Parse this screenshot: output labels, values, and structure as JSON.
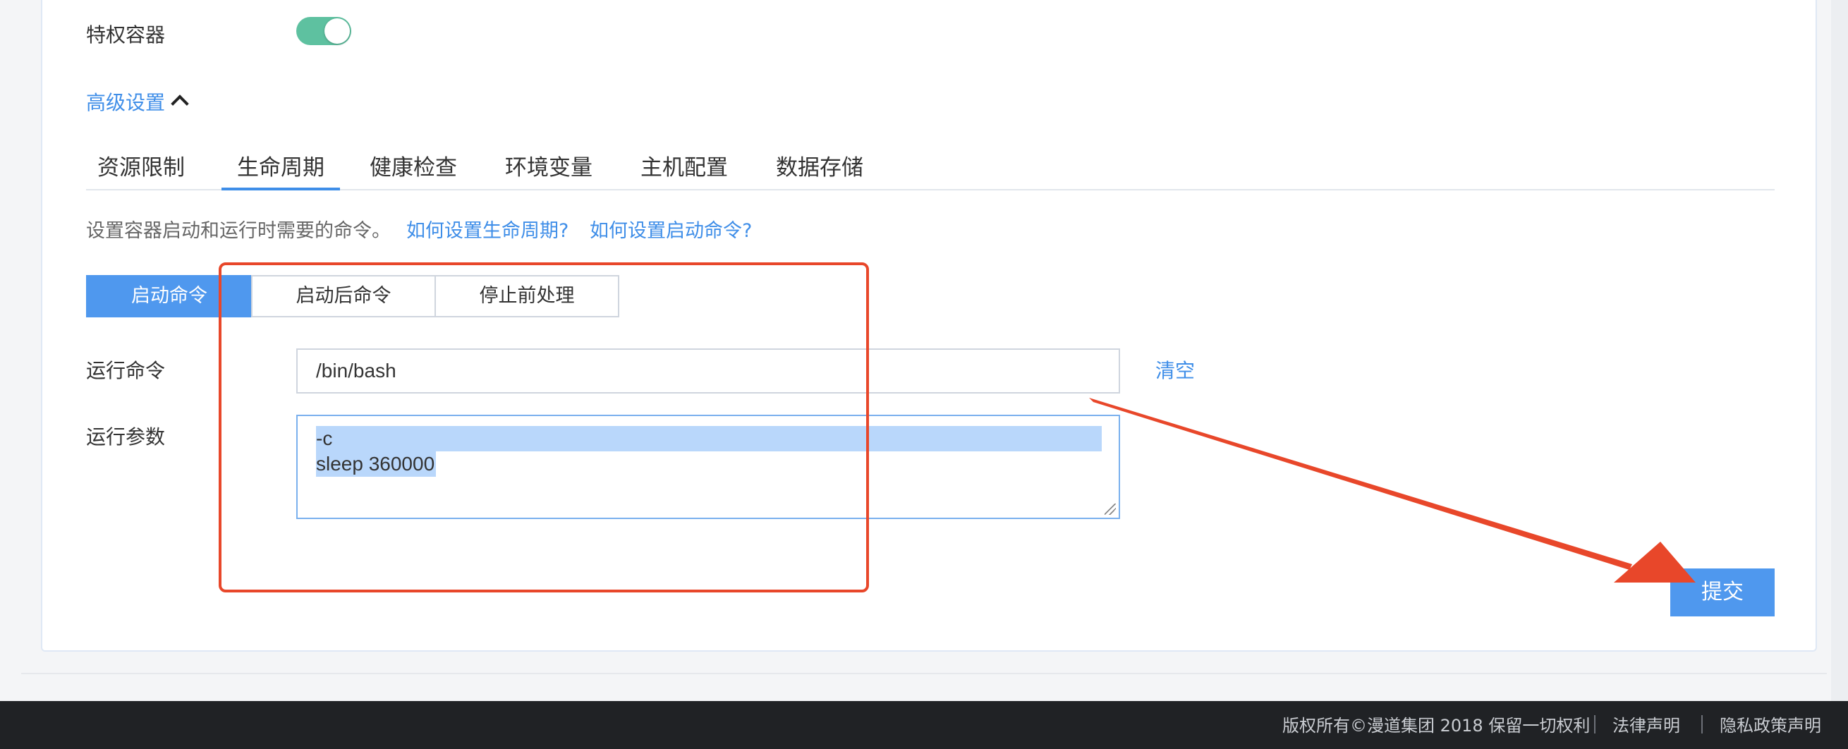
{
  "privileged": {
    "label": "特权容器",
    "enabled": true
  },
  "advanced": {
    "label": "高级设置",
    "expanded": true
  },
  "tabs": [
    {
      "label": "资源限制",
      "active": false
    },
    {
      "label": "生命周期",
      "active": true
    },
    {
      "label": "健康检查",
      "active": false
    },
    {
      "label": "环境变量",
      "active": false
    },
    {
      "label": "主机配置",
      "active": false
    },
    {
      "label": "数据存储",
      "active": false
    }
  ],
  "description": "设置容器启动和运行时需要的命令。",
  "help_links": [
    "如何设置生命周期?",
    "如何设置启动命令?"
  ],
  "segments": [
    {
      "label": "启动命令",
      "active": true
    },
    {
      "label": "启动后命令",
      "active": false
    },
    {
      "label": "停止前处理",
      "active": false
    }
  ],
  "command": {
    "label": "运行命令",
    "value": "/bin/bash",
    "clear_label": "清空"
  },
  "args": {
    "label": "运行参数",
    "lines": [
      "-c",
      "sleep 360000"
    ]
  },
  "submit_label": "提交",
  "footer": {
    "copyright": "版权所有©漫道集团 2018 保留一切权利",
    "links": [
      "法律声明",
      "隐私政策声明"
    ]
  },
  "colors": {
    "accent": "#3f8ee8",
    "primary_button": "#4f98ee",
    "toggle_on": "#5ec1a0",
    "annotation": "#e8472a",
    "footer_bg": "#202225"
  }
}
